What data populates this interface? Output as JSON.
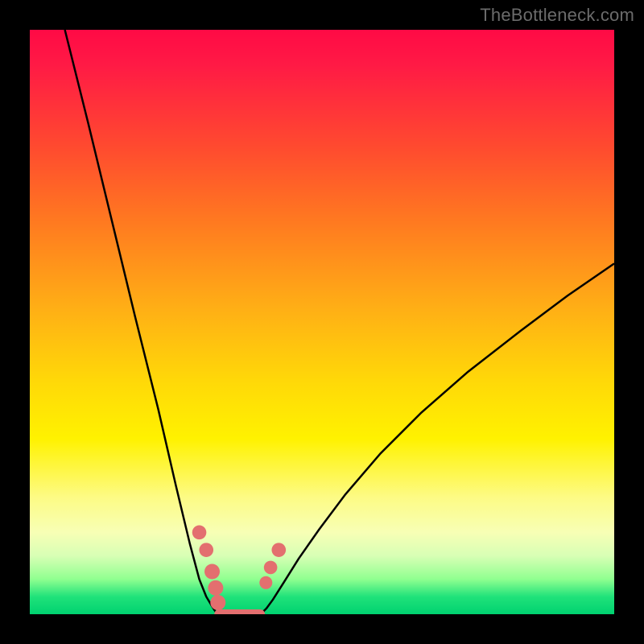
{
  "watermark": "TheBottleneck.com",
  "chart_data": {
    "type": "line",
    "title": "",
    "xlabel": "",
    "ylabel": "",
    "xlim": [
      0,
      100
    ],
    "ylim": [
      0,
      100
    ],
    "grid": false,
    "legend": false,
    "gradient_stops": [
      {
        "pos": 0,
        "color": "#ff0a45"
      },
      {
        "pos": 6,
        "color": "#ff1a45"
      },
      {
        "pos": 20,
        "color": "#ff4a2f"
      },
      {
        "pos": 33,
        "color": "#ff7a20"
      },
      {
        "pos": 48,
        "color": "#ffb015"
      },
      {
        "pos": 60,
        "color": "#ffd808"
      },
      {
        "pos": 70,
        "color": "#fff200"
      },
      {
        "pos": 80,
        "color": "#fdfb85"
      },
      {
        "pos": 86,
        "color": "#f7ffb5"
      },
      {
        "pos": 90,
        "color": "#d8ffb5"
      },
      {
        "pos": 94,
        "color": "#90ff90"
      },
      {
        "pos": 97,
        "color": "#20e27a"
      },
      {
        "pos": 100,
        "color": "#00d270"
      }
    ],
    "series": [
      {
        "name": "left-curve",
        "color": "#000000",
        "width": 2.5,
        "x": [
          6.0,
          10.0,
          14.0,
          18.0,
          22.0,
          25.0,
          27.4,
          29.0,
          30.2,
          31.1,
          31.6,
          31.9,
          32.4
        ],
        "y": [
          100.0,
          84.0,
          67.5,
          51.0,
          35.0,
          22.0,
          12.0,
          6.0,
          3.0,
          1.5,
          0.7,
          0.3,
          0.0
        ]
      },
      {
        "name": "right-curve",
        "color": "#000000",
        "width": 2.5,
        "x": [
          39.4,
          39.8,
          40.5,
          41.6,
          43.5,
          46.0,
          49.5,
          54.0,
          60.0,
          67.0,
          75.0,
          84.0,
          92.0,
          100.0
        ],
        "y": [
          0.0,
          0.3,
          1.0,
          2.5,
          5.5,
          9.5,
          14.5,
          20.5,
          27.5,
          34.5,
          41.5,
          48.5,
          54.5,
          60.0
        ]
      },
      {
        "name": "bottom-connector",
        "color": "#e36f6f",
        "width": 12,
        "linecap": "round",
        "x": [
          32.4,
          35.0,
          37.0,
          39.4
        ],
        "y": [
          0.0,
          0.0,
          0.0,
          0.0
        ]
      }
    ],
    "markers": [
      {
        "name": "left-dot-upper",
        "x": 29.0,
        "y": 14.0,
        "r": 8.8,
        "color": "#e36f6f"
      },
      {
        "name": "left-dot-lower",
        "x": 30.2,
        "y": 11.0,
        "r": 8.8,
        "color": "#e36f6f"
      },
      {
        "name": "left-bar-top",
        "x": 31.2,
        "y": 7.3,
        "r": 9.5,
        "color": "#e36f6f"
      },
      {
        "name": "left-bar-mid1",
        "x": 31.8,
        "y": 4.5,
        "r": 9.5,
        "color": "#e36f6f"
      },
      {
        "name": "left-bar-mid2",
        "x": 32.2,
        "y": 2.0,
        "r": 9.5,
        "color": "#e36f6f"
      },
      {
        "name": "right-dot-1",
        "x": 40.4,
        "y": 5.4,
        "r": 8.0,
        "color": "#e36f6f"
      },
      {
        "name": "right-dot-2",
        "x": 41.2,
        "y": 8.0,
        "r": 8.3,
        "color": "#e36f6f"
      },
      {
        "name": "right-dot-3",
        "x": 42.6,
        "y": 11.0,
        "r": 8.8,
        "color": "#e36f6f"
      }
    ]
  }
}
